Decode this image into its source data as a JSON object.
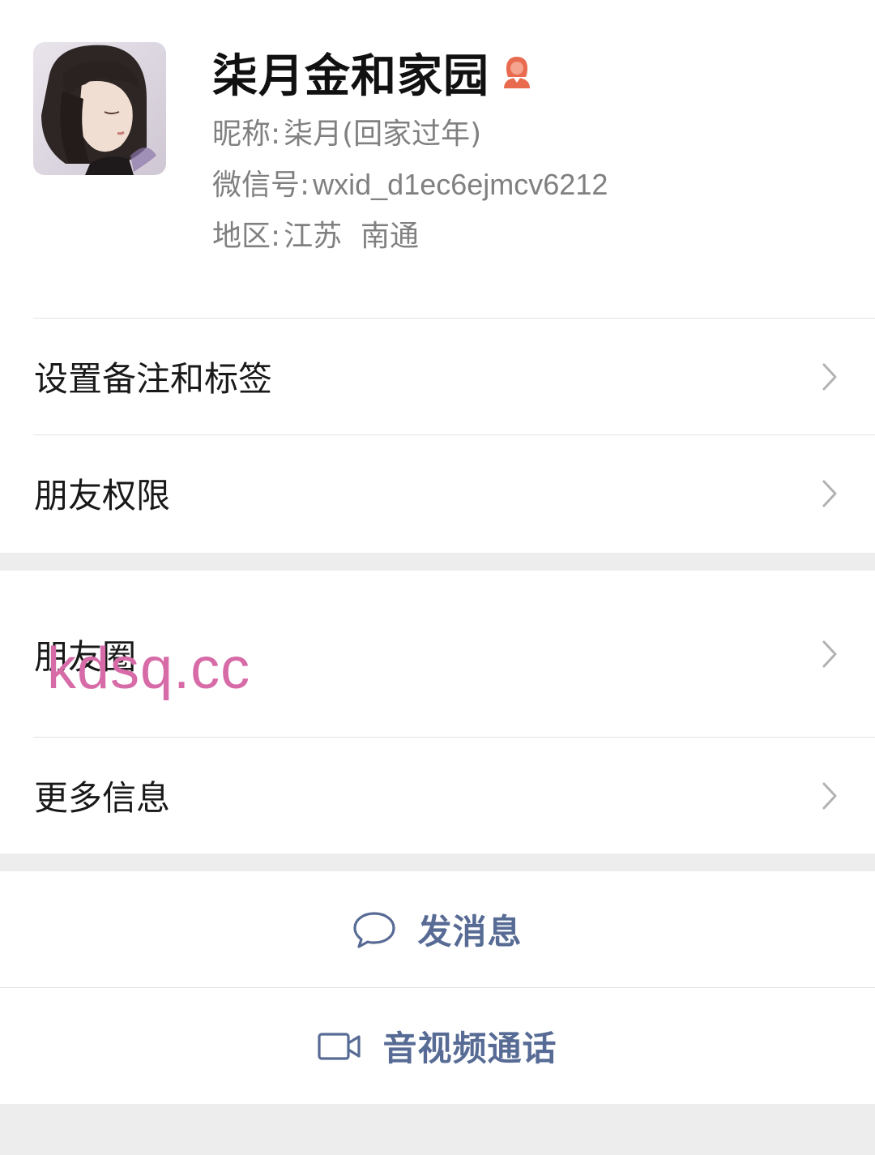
{
  "profile": {
    "name": "柒月金和家园",
    "nickname_label": "昵称:",
    "nickname": "柒月(回家过年)",
    "wxid_label": "微信号:",
    "wxid": "wxid_d1ec6ejmcv6212",
    "region_label": "地区:",
    "region": "江苏  南通",
    "gender_icon": "female-person-icon",
    "gender_icon_color": "#e86b4f"
  },
  "menu": {
    "remark_tags": "设置备注和标签",
    "friend_permissions": "朋友权限",
    "moments": "朋友圈",
    "more_info": "更多信息"
  },
  "watermark": "kdsq.cc",
  "actions": {
    "send_message": "发消息",
    "av_call": "音视频通话"
  },
  "colors": {
    "link_blue": "#576b95",
    "background": "#ededed",
    "watermark": "#d66ba8"
  }
}
